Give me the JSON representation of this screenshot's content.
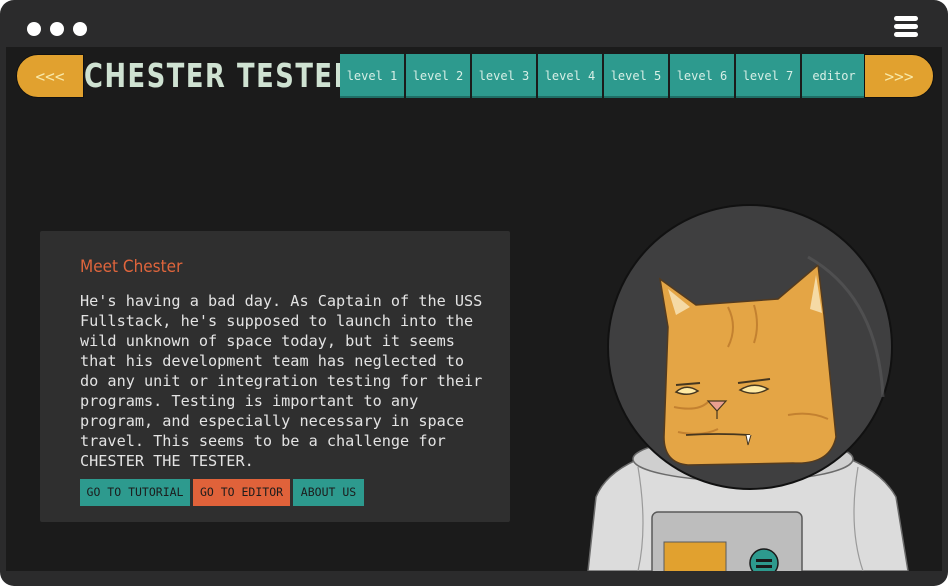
{
  "window": {
    "controls": [
      "dot",
      "dot",
      "dot"
    ],
    "menu_icon": "hamburger-icon"
  },
  "header": {
    "prev_label": "<<<",
    "brand": "CHESTER TESTER",
    "levels": [
      "level 1",
      "level 2",
      "level 3",
      "level 4",
      "level 5",
      "level 6",
      "level 7",
      "editor"
    ],
    "next_label": ">>>"
  },
  "intro": {
    "title": "Meet Chester",
    "body": "He's having a bad day. As Captain of the USS Fullstack, he's supposed to launch into the wild unknown of space today, but it seems that his development team has neglected to do any unit or integration testing for their programs. Testing is important to any program, and especially necessary in space travel. This seems to be a challenge for CHESTER THE TESTER.",
    "buttons": {
      "tutorial": "GO TO TUTORIAL",
      "editor": "GO TO EDITOR",
      "about": "ABOUT US"
    }
  },
  "colors": {
    "teal": "#2d9a8e",
    "orange": "#e1a12f",
    "red": "#e0623a",
    "background": "#1b1b1b"
  },
  "illustration": "cat-astronaut"
}
